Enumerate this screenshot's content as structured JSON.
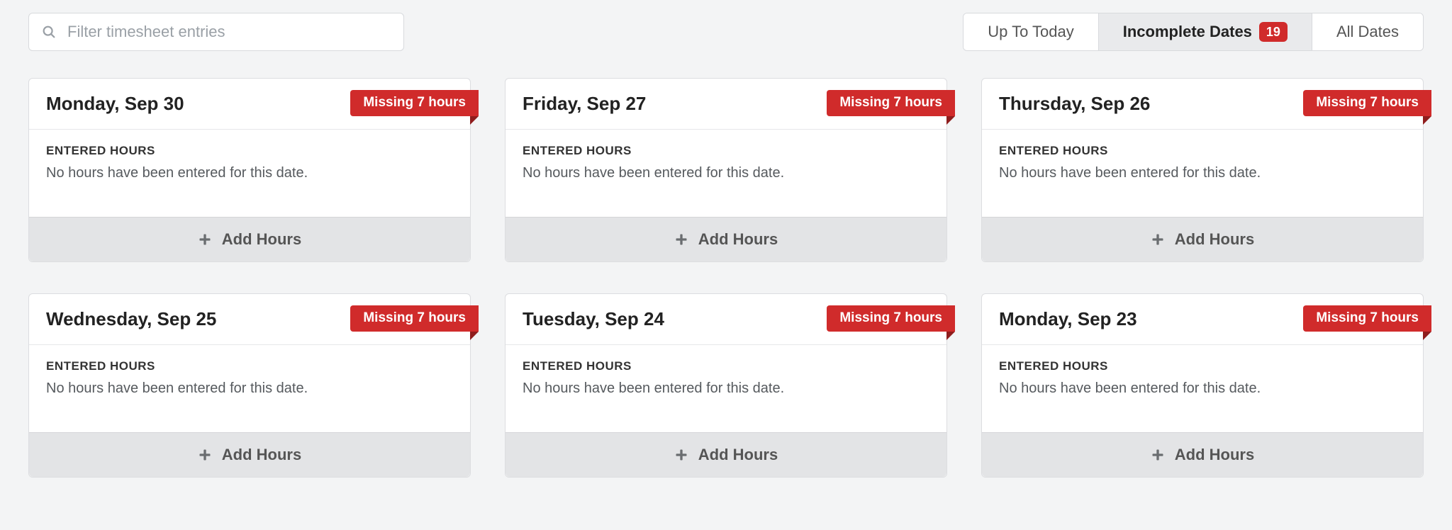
{
  "filter": {
    "placeholder": "Filter timesheet entries"
  },
  "tabs": {
    "up_to_today": "Up To Today",
    "incomplete": "Incomplete Dates",
    "incomplete_badge": "19",
    "all": "All Dates"
  },
  "labels": {
    "entered_hours": "ENTERED HOURS",
    "no_hours": "No hours have been entered for this date.",
    "add_hours": "Add Hours"
  },
  "cards": [
    {
      "date": "Monday, Sep 30",
      "ribbon": "Missing 7 hours"
    },
    {
      "date": "Friday, Sep 27",
      "ribbon": "Missing 7 hours"
    },
    {
      "date": "Thursday, Sep 26",
      "ribbon": "Missing 7 hours"
    },
    {
      "date": "Wednesday, Sep 25",
      "ribbon": "Missing 7 hours"
    },
    {
      "date": "Tuesday, Sep 24",
      "ribbon": "Missing 7 hours"
    },
    {
      "date": "Monday, Sep 23",
      "ribbon": "Missing 7 hours"
    }
  ]
}
